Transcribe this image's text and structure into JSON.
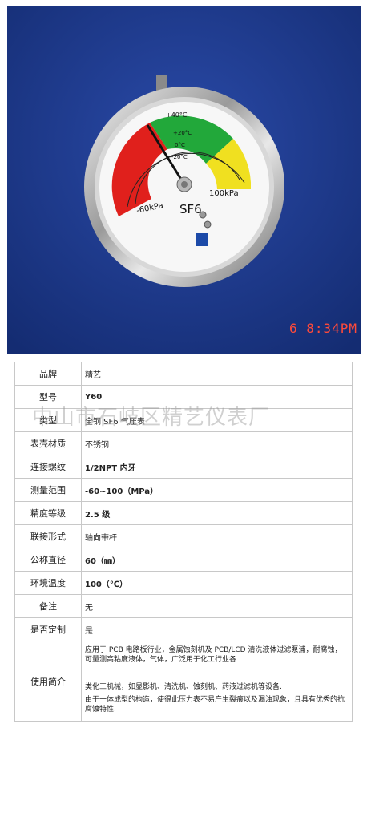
{
  "photo": {
    "gauge": {
      "label_top": "+40°C",
      "label_left": "-60kPa",
      "label_right": "100kPa",
      "label_sf6": "SF6",
      "temp_labels": [
        "+20°C",
        "0°C",
        "-20°C"
      ]
    },
    "timestamp": "6  8:34PM",
    "colors": {
      "red": "#e0201c",
      "green": "#22a83a",
      "yellow": "#f0e020",
      "background": "#1c3a8e"
    }
  },
  "watermark": "中山市石岐区精艺仪表厂",
  "specs": [
    {
      "label": "品牌",
      "value": "精艺",
      "bold": false
    },
    {
      "label": "型号",
      "value": "Y60",
      "bold": true
    },
    {
      "label": "类型",
      "value": "全钢 SF6 气压表",
      "bold": false
    },
    {
      "label": "表壳材质",
      "value": "不锈钢",
      "bold": false
    },
    {
      "label": "连接螺纹",
      "value": "1/2NPT 内牙",
      "bold": true
    },
    {
      "label": "测量范围",
      "value": "-60~100（MPa）",
      "bold": true
    },
    {
      "label": "精度等级",
      "value": "2.5 级",
      "bold": true
    },
    {
      "label": "联接形式",
      "value": "轴向带杆",
      "bold": false
    },
    {
      "label": "公称直径",
      "value": "60（㎜）",
      "bold": true
    },
    {
      "label": "环境温度",
      "value": "100（℃）",
      "bold": true
    },
    {
      "label": "备注",
      "value": "无",
      "bold": false
    },
    {
      "label": "是否定制",
      "value": "是",
      "bold": false
    }
  ],
  "usage": {
    "label": "使用简介",
    "paragraphs": [
      "应用于 PCB 电路板行业，金属蚀刻机及 PCB/LCD 清洗液体过滤泵浦，耐腐蚀，可量测高粘度液体，气体，广泛用于化工行业各",
      "类化工机械，如显影机、清洗机、蚀刻机、药液过滤机等设备.",
      "由于一体成型的构造，使得此压力表不易产生裂痕以及漏油现象，且具有优秀的抗腐蚀特性."
    ]
  }
}
